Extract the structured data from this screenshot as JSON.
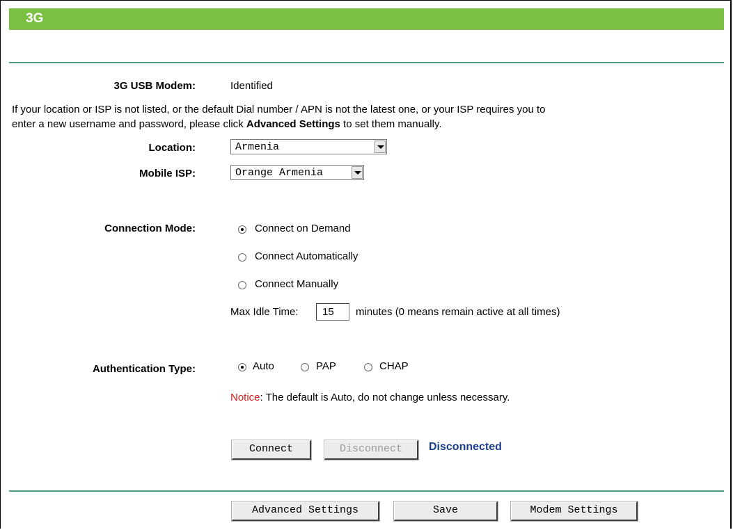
{
  "title": "3G",
  "modem": {
    "label": "3G USB Modem:",
    "value": "Identified"
  },
  "info": {
    "line1": "If your location or ISP is not listed, or the default Dial number / APN is not the latest one, or your ISP requires you to",
    "line2_prefix": "enter a new username and password, please click ",
    "line2_bold": "Advanced Settings",
    "line2_suffix": " to set them manually."
  },
  "location": {
    "label": "Location:",
    "value": "Armenia"
  },
  "mobile_isp": {
    "label": "Mobile ISP:",
    "value": "Orange Armenia"
  },
  "connection_mode": {
    "label": "Connection Mode:",
    "options": [
      "Connect on Demand",
      "Connect Automatically",
      "Connect Manually"
    ],
    "selected": "Connect on Demand"
  },
  "idle": {
    "prefix": "Max Idle Time:",
    "value": "15",
    "suffix": "minutes (0 means remain active at all times)"
  },
  "auth": {
    "label": "Authentication Type:",
    "options": [
      "Auto",
      "PAP",
      "CHAP"
    ],
    "selected": "Auto"
  },
  "notice": {
    "label": "Notice",
    "text": ": The default is Auto, do not change unless necessary."
  },
  "buttons": {
    "connect": "Connect",
    "disconnect": "Disconnect",
    "advanced": "Advanced Settings",
    "save": "Save",
    "modem": "Modem Settings"
  },
  "status": "Disconnected",
  "colors": {
    "title_bar": "#7ac143",
    "divider": "#4f9a8a",
    "status": "#1b3e8a",
    "notice": "#d21e1e"
  }
}
